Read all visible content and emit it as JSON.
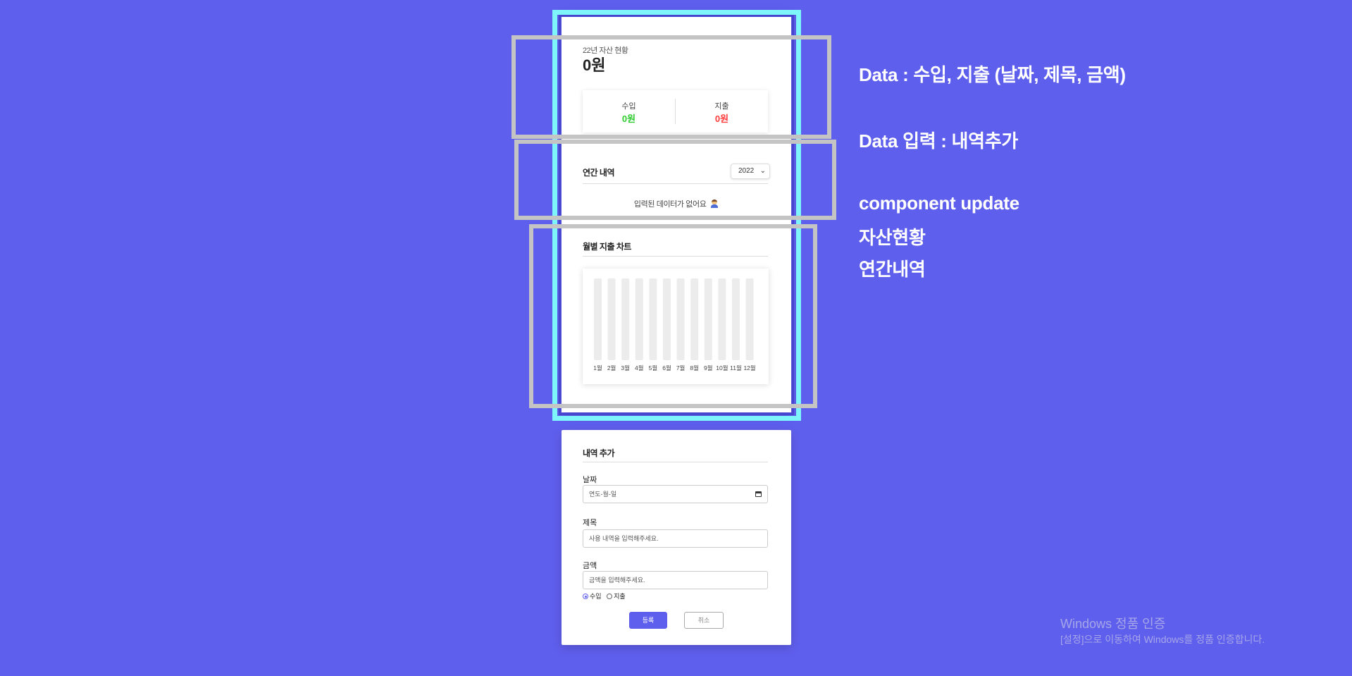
{
  "colors": {
    "background": "#5f5fee",
    "income": "#2ecc2e",
    "expense": "#ff3b3b",
    "accent": "#5f5fee",
    "highlight_frame": "#7ef4fb",
    "annotation_frame": "#c4c4c4"
  },
  "asset": {
    "label": "22년 자산 현황",
    "total": "0원"
  },
  "summary": {
    "income_label": "수입",
    "income_value": "0원",
    "expense_label": "지출",
    "expense_value": "0원"
  },
  "annual": {
    "title": "연간 내역",
    "year_selected": "2022",
    "empty_message": "입력된 데이터가 없어요"
  },
  "chart_data": {
    "type": "bar",
    "title": "월별 지출 차트",
    "categories": [
      "1월",
      "2월",
      "3월",
      "4월",
      "5월",
      "6월",
      "7월",
      "8월",
      "9월",
      "10월",
      "11월",
      "12월"
    ],
    "values": [
      0,
      0,
      0,
      0,
      0,
      0,
      0,
      0,
      0,
      0,
      0,
      0
    ],
    "grid": false,
    "legend": "none"
  },
  "add_form": {
    "title": "내역 추가",
    "date_label": "날짜",
    "date_placeholder": "연도-월-일",
    "title_label": "제목",
    "title_placeholder": "사용 내역을 입력해주세요.",
    "amount_label": "금액",
    "amount_placeholder": "금액을 입력해주세요.",
    "type_options": [
      "수입",
      "지출"
    ],
    "type_selected": "수입",
    "submit_label": "등록",
    "cancel_label": "취소"
  },
  "notes": [
    "Data : 수입, 지출 (날짜, 제목, 금액)",
    "Data 입력 : 내역추가",
    "component update",
    "자산현황",
    "연간내역"
  ],
  "watermark": {
    "title": "Windows 정품 인증",
    "subtitle": "[설정]으로 이동하여 Windows를 정품 인증합니다."
  }
}
